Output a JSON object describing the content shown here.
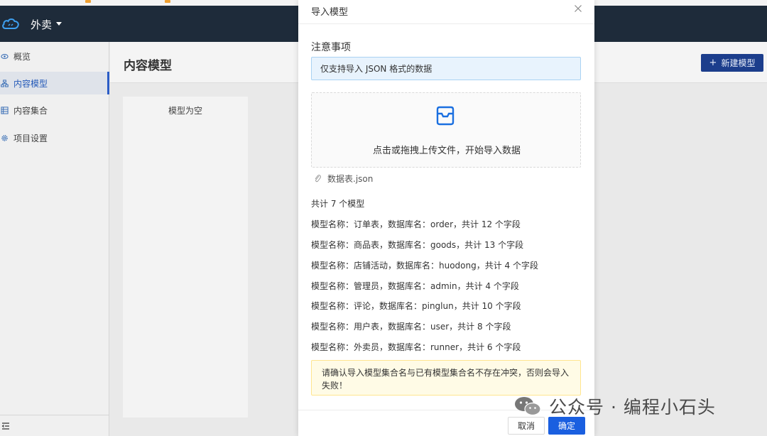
{
  "header": {
    "project_name": "外卖"
  },
  "sidebar": {
    "items": [
      {
        "label": "概览",
        "icon": "eye-icon"
      },
      {
        "label": "内容模型",
        "icon": "model-icon",
        "active": true
      },
      {
        "label": "内容集合",
        "icon": "collection-icon"
      },
      {
        "label": "项目设置",
        "icon": "gear-icon"
      }
    ]
  },
  "main": {
    "title": "内容模型",
    "new_model_label": "新建模型",
    "empty_text": "模型为空"
  },
  "modal": {
    "title": "导入模型",
    "notice_title": "注意事项",
    "info_text": "仅支持导入 JSON 格式的数据",
    "drop_text": "点击或拖拽上传文件，开始导入数据",
    "file_name": "数据表.json",
    "summary": "共计 7 个模型",
    "models": [
      "模型名称：订单表，数据库名：order，共计 12 个字段",
      "模型名称：商品表，数据库名：goods，共计 13 个字段",
      "模型名称：店铺活动，数据库名：huodong，共计 4 个字段",
      "模型名称：管理员，数据库名：admin，共计 4 个字段",
      "模型名称：评论，数据库名：pinglun，共计 10 个字段",
      "模型名称：用户表，数据库名：user，共计 8 个字段",
      "模型名称：外卖员，数据库名：runner，共计 6 个字段"
    ],
    "warning_text": "请确认导入模型集合名与已有模型集合名不存在冲突，否则会导入失败！",
    "cancel_label": "取消",
    "ok_label": "确定"
  },
  "watermark": {
    "text": "公众号 · 编程小石头"
  },
  "colors": {
    "header_bg": "#1e2b3a",
    "primary": "#1a5fe0",
    "active_nav": "#2359b8",
    "info_bg": "#e8f3fd",
    "warn_bg": "#fffbe6"
  }
}
